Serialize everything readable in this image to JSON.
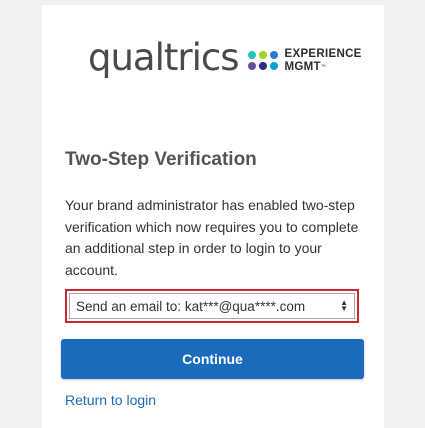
{
  "logo": {
    "wordmark": "qualtrics",
    "line1": "EXPERIENCE",
    "line2": "MGMT",
    "dot_colors": [
      "#21c3bb",
      "#9bd32b",
      "#2a7ad3",
      "#6a4d9e",
      "#2c2c80",
      "#0d9fd8"
    ]
  },
  "title": "Two-Step Verification",
  "description": "Your brand administrator has enabled two-step verification which now requires you to complete an additional step in order to login to your account.",
  "method_select": {
    "selected": "Send an email to: kat***@qua****.com"
  },
  "continue_label": "Continue",
  "return_link": "Return to login",
  "colors": {
    "primary": "#1b6bbd",
    "highlight_border": "#c8282e"
  }
}
